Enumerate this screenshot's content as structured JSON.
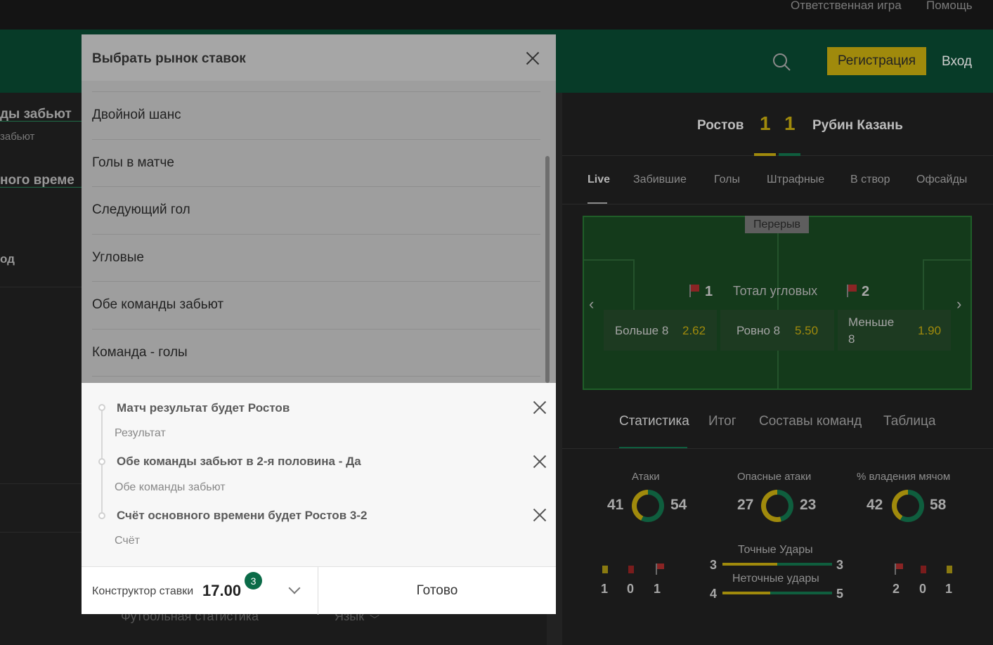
{
  "topbar": {
    "responsible": "Ответственная игра",
    "help": "Помощь"
  },
  "header": {
    "register": "Регистрация",
    "login": "Вход"
  },
  "left": {
    "line1": "ды забьют",
    "line2": "забьют",
    "line3": "ного време",
    "line4": "од",
    "footer_stats": "Футбольная статистика",
    "footer_lang": "Язык"
  },
  "match": {
    "home": "Ростов",
    "away": "Рубин Казань",
    "home_score": "1",
    "away_score": "1"
  },
  "match_tabs": [
    "Live",
    "Забившие",
    "Голы",
    "Штрафные",
    "В створ",
    "Офсайды"
  ],
  "pitch": {
    "status": "Перерыв",
    "corners_title": "Тотал угловых",
    "home_corners": "1",
    "away_corners": "2",
    "bets": [
      {
        "label": "Больше 8",
        "odds": "2.62"
      },
      {
        "label": "Ровно 8",
        "odds": "5.50"
      },
      {
        "label": "Меньше",
        "label2": "8",
        "odds": "1.90"
      }
    ]
  },
  "stats_tabs": [
    "Статистика",
    "Итог",
    "Составы команд",
    "Таблица"
  ],
  "stats": {
    "attacks": {
      "label": "Атаки",
      "home": "41",
      "away": "54"
    },
    "dangerous": {
      "label": "Опасные атаки",
      "home": "27",
      "away": "23"
    },
    "possession": {
      "label": "% владения мячом",
      "home": "42",
      "away": "58"
    },
    "on_target": {
      "label": "Точные Удары",
      "home": "3",
      "away": "3"
    },
    "off_target": {
      "label": "Неточные удары",
      "home": "4",
      "away": "5"
    },
    "home_cards": {
      "yellow": "1",
      "red": "0",
      "corners": "1"
    },
    "away_cards": {
      "corners": "2",
      "red": "0",
      "yellow": "1"
    }
  },
  "colors": {
    "accent": "#a08a0c",
    "brand": "#073b28",
    "badge": "#0b6b48"
  },
  "modal": {
    "title": "Выбрать рынок ставок",
    "markets": [
      "Двойной шанс",
      "Голы в матче",
      "Следующий гол",
      "Угловые",
      "Обе команды забьют",
      "Команда - голы"
    ]
  },
  "slip": {
    "selections": [
      {
        "title": "Матч результат будет Ростов",
        "market": "Результат"
      },
      {
        "title": "Обе команды забьют в 2-я половина - Да",
        "market": "Обе команды забьют"
      },
      {
        "title": "Счёт основного времени будет Ростов 3-2",
        "market": "Счёт"
      }
    ],
    "builder_label": "Конструктор ставки",
    "builder_odds": "17.00",
    "count": "3",
    "done": "Готово"
  }
}
